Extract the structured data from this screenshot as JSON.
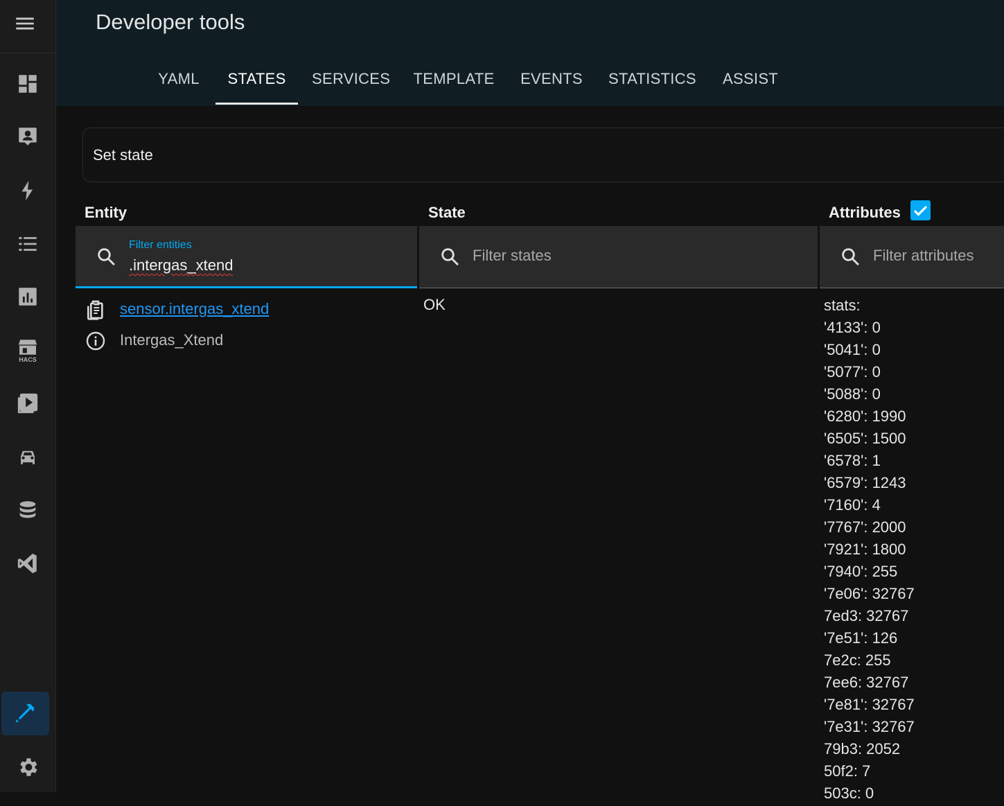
{
  "header": {
    "title": "Developer tools",
    "tabs": [
      "YAML",
      "STATES",
      "SERVICES",
      "TEMPLATE",
      "EVENTS",
      "STATISTICS",
      "ASSIST"
    ],
    "active_tab": "STATES"
  },
  "sidebar": {
    "items": [
      "menu-icon",
      "dashboard-icon",
      "account-box-icon",
      "energy-icon",
      "logbook-icon",
      "history-icon",
      "hacs-icon",
      "media-icon",
      "car-icon",
      "database-icon",
      "vscode-icon",
      "developer-tools-icon",
      "settings-icon"
    ],
    "hacs_label": "HACS",
    "active": "developer-tools-icon",
    "accent": "#03a9f4"
  },
  "set_state": {
    "title": "Set state"
  },
  "columns": {
    "entity": "Entity",
    "state": "State",
    "attributes": "Attributes",
    "attributes_checked": true
  },
  "filters": {
    "entity_label": "Filter entities",
    "entity_value": ".intergas_xtend",
    "state_placeholder": "Filter states",
    "attributes_placeholder": "Filter attributes"
  },
  "row": {
    "entity_id": "sensor.intergas_xtend",
    "friendly_name": "Intergas_Xtend",
    "state": "OK",
    "attributes": [
      "stats:",
      "'4133': 0",
      "'5041': 0",
      "'5077': 0",
      "'5088': 0",
      "'6280': 1990",
      "'6505': 1500",
      "'6578': 1",
      "'6579': 1243",
      "'7160': 4",
      "'7767': 2000",
      "'7921': 1800",
      "'7940': 255",
      "'7e06': 32767",
      "7ed3: 32767",
      "'7e51': 126",
      "7e2c: 255",
      "7ee6: 32767",
      "'7e81': 32767",
      "'7e31': 32767",
      "79b3: 2052",
      "50f2: 7",
      "503c: 0"
    ]
  }
}
